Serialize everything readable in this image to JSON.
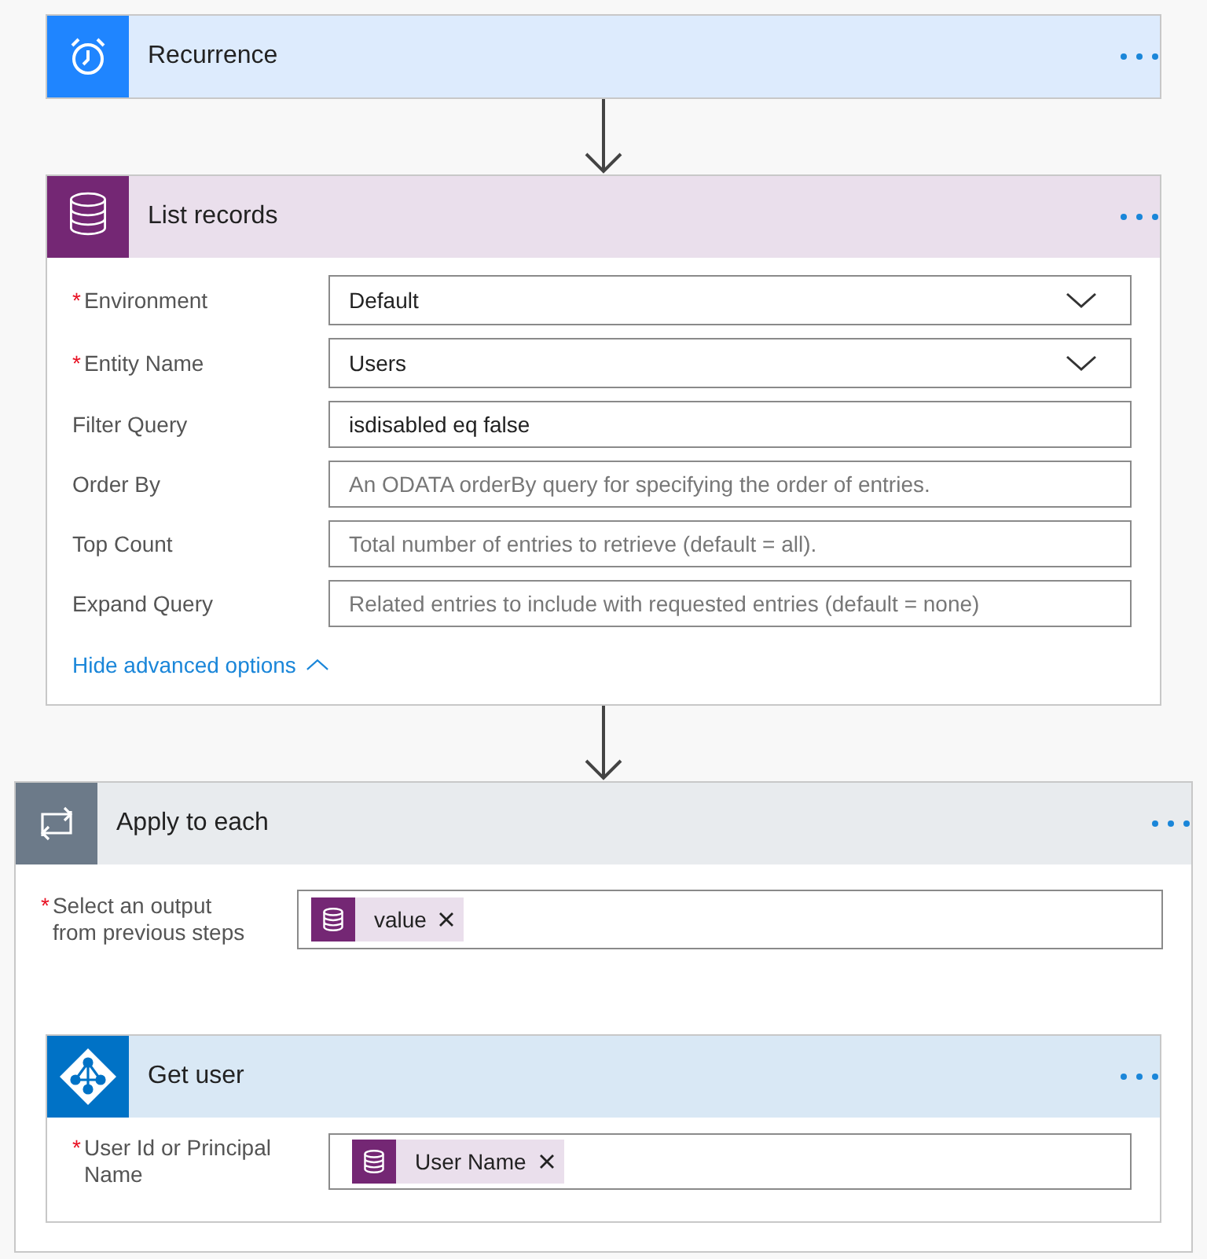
{
  "steps": [
    {
      "kind": "recurrence",
      "title": "Recurrence"
    },
    {
      "kind": "dataverse",
      "title": "List records",
      "fields": [
        {
          "kind": "dropdown",
          "mark": "*",
          "label": "Environment",
          "value": "Default"
        },
        {
          "kind": "dropdown",
          "mark": "*",
          "label": "Entity Name",
          "value": "Users"
        },
        {
          "kind": "text",
          "label": "Filter Query",
          "value": "isdisabled eq false"
        },
        {
          "kind": "text",
          "label": "Order By",
          "placeholder": "An ODATA orderBy query for specifying the order of entries."
        },
        {
          "kind": "text",
          "label": "Top Count",
          "placeholder": "Total number of entries to retrieve (default = all)."
        },
        {
          "kind": "text",
          "label": "Expand Query",
          "placeholder": "Related entries to include with requested entries (default = none)"
        }
      ],
      "advanced": {
        "label": "Hide advanced options",
        "expanded": true
      }
    },
    {
      "kind": "loop",
      "title": "Apply to each",
      "fields": [
        {
          "kind": "token",
          "mark": "*",
          "label": "Select an output from previous steps",
          "tokens": [
            "value"
          ]
        }
      ],
      "children": [
        {
          "kind": "directory",
          "title": "Get user",
          "fields": [
            {
              "kind": "token",
              "mark": "*",
              "label": "User Id or Principal Name",
              "tokens": [
                "User Name"
              ]
            }
          ]
        }
      ]
    }
  ]
}
